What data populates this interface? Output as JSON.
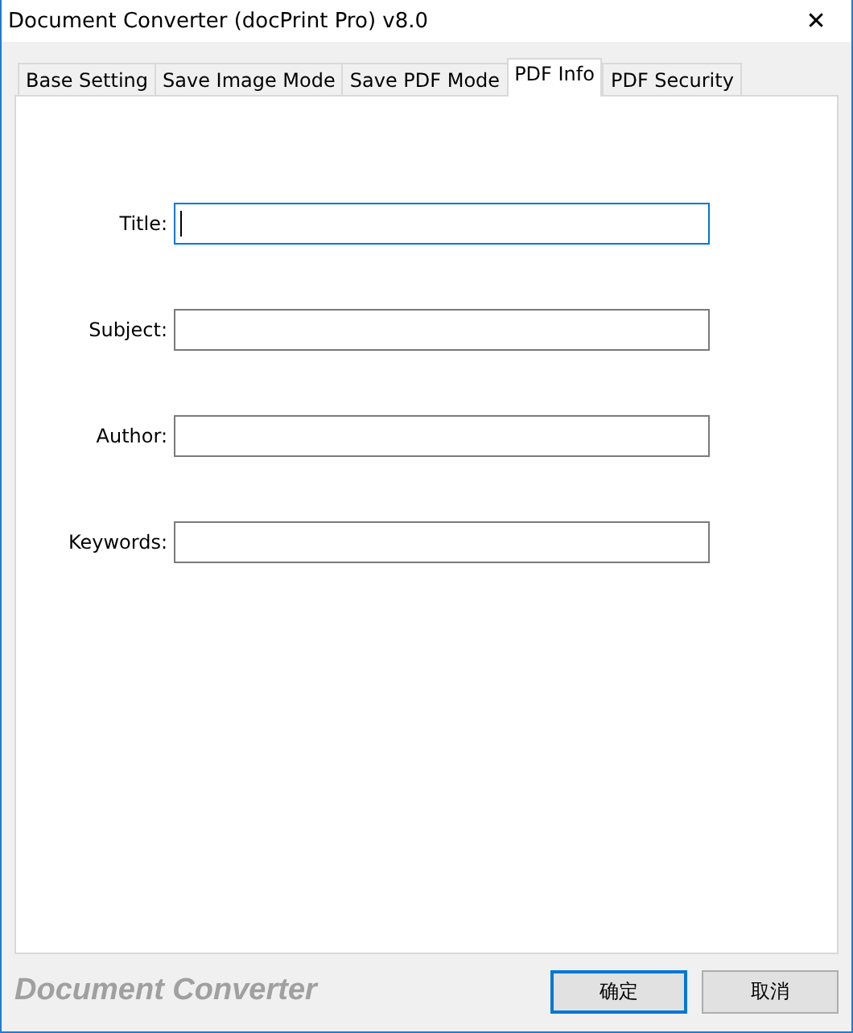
{
  "window": {
    "title": "Document Converter (docPrint Pro) v8.0",
    "close": "✕"
  },
  "tabs": [
    {
      "label": "Base Setting",
      "selected": false
    },
    {
      "label": "Save Image Mode",
      "selected": false
    },
    {
      "label": "Save PDF Mode",
      "selected": false
    },
    {
      "label": "PDF Info",
      "selected": true
    },
    {
      "label": "PDF Security",
      "selected": false
    }
  ],
  "fields": [
    {
      "label": "Title:",
      "focused": true
    },
    {
      "label": "Subject:",
      "focused": false
    },
    {
      "label": "Author:",
      "focused": false
    },
    {
      "label": "Keywords:",
      "focused": false
    }
  ],
  "footer": {
    "brand": "Document Converter"
  },
  "buttons": [
    {
      "label": "确定",
      "default": true
    },
    {
      "label": "取消",
      "default": false
    }
  ]
}
